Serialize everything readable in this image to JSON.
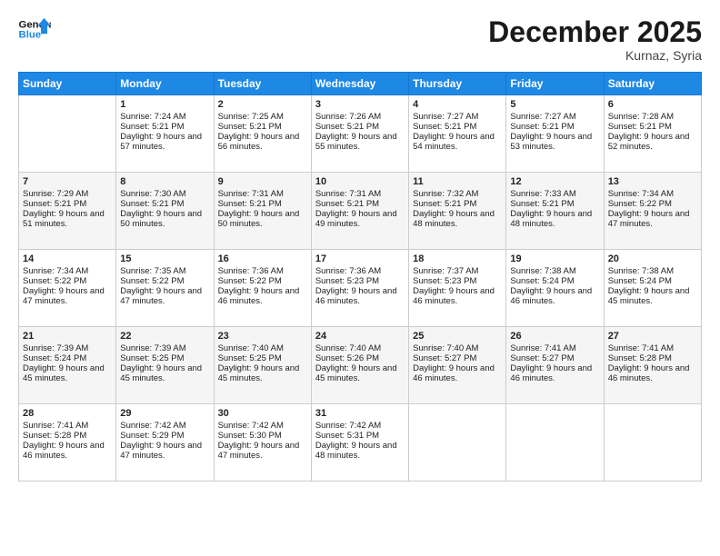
{
  "header": {
    "logo_line1": "General",
    "logo_line2": "Blue",
    "month": "December 2025",
    "location": "Kurnaz, Syria"
  },
  "days_of_week": [
    "Sunday",
    "Monday",
    "Tuesday",
    "Wednesday",
    "Thursday",
    "Friday",
    "Saturday"
  ],
  "weeks": [
    [
      {
        "day": "",
        "sunrise": "",
        "sunset": "",
        "daylight": ""
      },
      {
        "day": "1",
        "sunrise": "Sunrise: 7:24 AM",
        "sunset": "Sunset: 5:21 PM",
        "daylight": "Daylight: 9 hours and 57 minutes."
      },
      {
        "day": "2",
        "sunrise": "Sunrise: 7:25 AM",
        "sunset": "Sunset: 5:21 PM",
        "daylight": "Daylight: 9 hours and 56 minutes."
      },
      {
        "day": "3",
        "sunrise": "Sunrise: 7:26 AM",
        "sunset": "Sunset: 5:21 PM",
        "daylight": "Daylight: 9 hours and 55 minutes."
      },
      {
        "day": "4",
        "sunrise": "Sunrise: 7:27 AM",
        "sunset": "Sunset: 5:21 PM",
        "daylight": "Daylight: 9 hours and 54 minutes."
      },
      {
        "day": "5",
        "sunrise": "Sunrise: 7:27 AM",
        "sunset": "Sunset: 5:21 PM",
        "daylight": "Daylight: 9 hours and 53 minutes."
      },
      {
        "day": "6",
        "sunrise": "Sunrise: 7:28 AM",
        "sunset": "Sunset: 5:21 PM",
        "daylight": "Daylight: 9 hours and 52 minutes."
      }
    ],
    [
      {
        "day": "7",
        "sunrise": "Sunrise: 7:29 AM",
        "sunset": "Sunset: 5:21 PM",
        "daylight": "Daylight: 9 hours and 51 minutes."
      },
      {
        "day": "8",
        "sunrise": "Sunrise: 7:30 AM",
        "sunset": "Sunset: 5:21 PM",
        "daylight": "Daylight: 9 hours and 50 minutes."
      },
      {
        "day": "9",
        "sunrise": "Sunrise: 7:31 AM",
        "sunset": "Sunset: 5:21 PM",
        "daylight": "Daylight: 9 hours and 50 minutes."
      },
      {
        "day": "10",
        "sunrise": "Sunrise: 7:31 AM",
        "sunset": "Sunset: 5:21 PM",
        "daylight": "Daylight: 9 hours and 49 minutes."
      },
      {
        "day": "11",
        "sunrise": "Sunrise: 7:32 AM",
        "sunset": "Sunset: 5:21 PM",
        "daylight": "Daylight: 9 hours and 48 minutes."
      },
      {
        "day": "12",
        "sunrise": "Sunrise: 7:33 AM",
        "sunset": "Sunset: 5:21 PM",
        "daylight": "Daylight: 9 hours and 48 minutes."
      },
      {
        "day": "13",
        "sunrise": "Sunrise: 7:34 AM",
        "sunset": "Sunset: 5:22 PM",
        "daylight": "Daylight: 9 hours and 47 minutes."
      }
    ],
    [
      {
        "day": "14",
        "sunrise": "Sunrise: 7:34 AM",
        "sunset": "Sunset: 5:22 PM",
        "daylight": "Daylight: 9 hours and 47 minutes."
      },
      {
        "day": "15",
        "sunrise": "Sunrise: 7:35 AM",
        "sunset": "Sunset: 5:22 PM",
        "daylight": "Daylight: 9 hours and 47 minutes."
      },
      {
        "day": "16",
        "sunrise": "Sunrise: 7:36 AM",
        "sunset": "Sunset: 5:22 PM",
        "daylight": "Daylight: 9 hours and 46 minutes."
      },
      {
        "day": "17",
        "sunrise": "Sunrise: 7:36 AM",
        "sunset": "Sunset: 5:23 PM",
        "daylight": "Daylight: 9 hours and 46 minutes."
      },
      {
        "day": "18",
        "sunrise": "Sunrise: 7:37 AM",
        "sunset": "Sunset: 5:23 PM",
        "daylight": "Daylight: 9 hours and 46 minutes."
      },
      {
        "day": "19",
        "sunrise": "Sunrise: 7:38 AM",
        "sunset": "Sunset: 5:24 PM",
        "daylight": "Daylight: 9 hours and 46 minutes."
      },
      {
        "day": "20",
        "sunrise": "Sunrise: 7:38 AM",
        "sunset": "Sunset: 5:24 PM",
        "daylight": "Daylight: 9 hours and 45 minutes."
      }
    ],
    [
      {
        "day": "21",
        "sunrise": "Sunrise: 7:39 AM",
        "sunset": "Sunset: 5:24 PM",
        "daylight": "Daylight: 9 hours and 45 minutes."
      },
      {
        "day": "22",
        "sunrise": "Sunrise: 7:39 AM",
        "sunset": "Sunset: 5:25 PM",
        "daylight": "Daylight: 9 hours and 45 minutes."
      },
      {
        "day": "23",
        "sunrise": "Sunrise: 7:40 AM",
        "sunset": "Sunset: 5:25 PM",
        "daylight": "Daylight: 9 hours and 45 minutes."
      },
      {
        "day": "24",
        "sunrise": "Sunrise: 7:40 AM",
        "sunset": "Sunset: 5:26 PM",
        "daylight": "Daylight: 9 hours and 45 minutes."
      },
      {
        "day": "25",
        "sunrise": "Sunrise: 7:40 AM",
        "sunset": "Sunset: 5:27 PM",
        "daylight": "Daylight: 9 hours and 46 minutes."
      },
      {
        "day": "26",
        "sunrise": "Sunrise: 7:41 AM",
        "sunset": "Sunset: 5:27 PM",
        "daylight": "Daylight: 9 hours and 46 minutes."
      },
      {
        "day": "27",
        "sunrise": "Sunrise: 7:41 AM",
        "sunset": "Sunset: 5:28 PM",
        "daylight": "Daylight: 9 hours and 46 minutes."
      }
    ],
    [
      {
        "day": "28",
        "sunrise": "Sunrise: 7:41 AM",
        "sunset": "Sunset: 5:28 PM",
        "daylight": "Daylight: 9 hours and 46 minutes."
      },
      {
        "day": "29",
        "sunrise": "Sunrise: 7:42 AM",
        "sunset": "Sunset: 5:29 PM",
        "daylight": "Daylight: 9 hours and 47 minutes."
      },
      {
        "day": "30",
        "sunrise": "Sunrise: 7:42 AM",
        "sunset": "Sunset: 5:30 PM",
        "daylight": "Daylight: 9 hours and 47 minutes."
      },
      {
        "day": "31",
        "sunrise": "Sunrise: 7:42 AM",
        "sunset": "Sunset: 5:31 PM",
        "daylight": "Daylight: 9 hours and 48 minutes."
      },
      {
        "day": "",
        "sunrise": "",
        "sunset": "",
        "daylight": ""
      },
      {
        "day": "",
        "sunrise": "",
        "sunset": "",
        "daylight": ""
      },
      {
        "day": "",
        "sunrise": "",
        "sunset": "",
        "daylight": ""
      }
    ]
  ]
}
